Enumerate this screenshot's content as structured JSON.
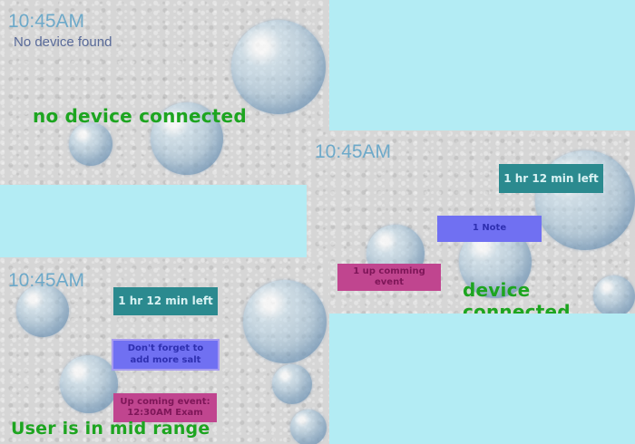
{
  "panel_no_device": {
    "clock": "10:45AM",
    "status": "No device found",
    "caption": "no device connected"
  },
  "panel_connected": {
    "clock": "10:45AM",
    "battery_tile": "1 hr 12 min left",
    "note_tile": "1 Note",
    "event_tile": "1 up comming event",
    "caption": "device connected"
  },
  "panel_mid_range": {
    "clock": "10:45AM",
    "battery_tile": "1 hr 12 min left",
    "note_tile": "Don't forget to add more salt",
    "event_tile": "Up coming event: 12:30AM  Exam",
    "caption": "User is in mid range"
  },
  "colors": {
    "background": "#b3ecf4",
    "clock": "#6da9c9",
    "caption_green": "#1da520",
    "tile_teal": "#2b8a8f",
    "tile_blue": "#7070f2",
    "tile_magenta": "#c0458f"
  }
}
